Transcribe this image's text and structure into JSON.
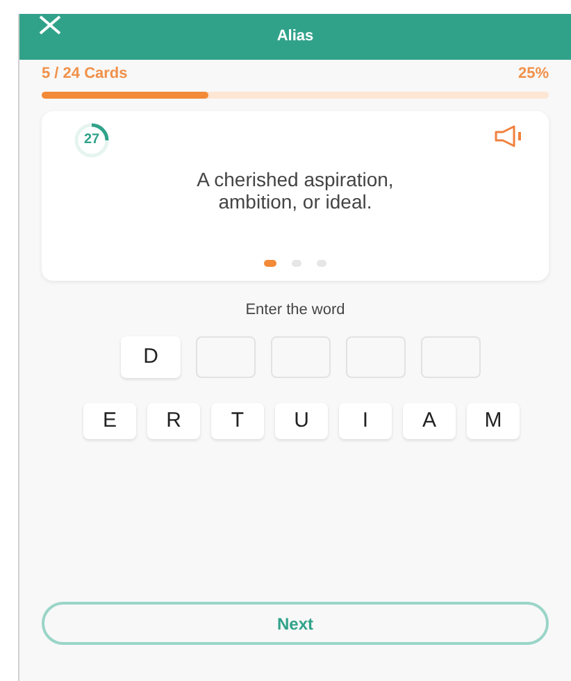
{
  "header": {
    "title": "Alias"
  },
  "progress": {
    "label": "5 / 24 Cards",
    "percent": "25%",
    "level": 0.33
  },
  "card": {
    "timer": "27",
    "definition": "A cherished aspiration, ambition, or ideal.",
    "pages": [
      {
        "selected": true
      },
      {
        "selected": false
      },
      {
        "selected": false
      }
    ]
  },
  "prompt": "Enter the word",
  "slots": [
    {
      "filled": true,
      "letter": "D"
    },
    {
      "filled": false
    },
    {
      "filled": false
    },
    {
      "filled": false
    },
    {
      "filled": false
    }
  ],
  "letters": [
    "E",
    "R",
    "T",
    "U",
    "I",
    "A",
    "M"
  ],
  "next_button": "Next"
}
